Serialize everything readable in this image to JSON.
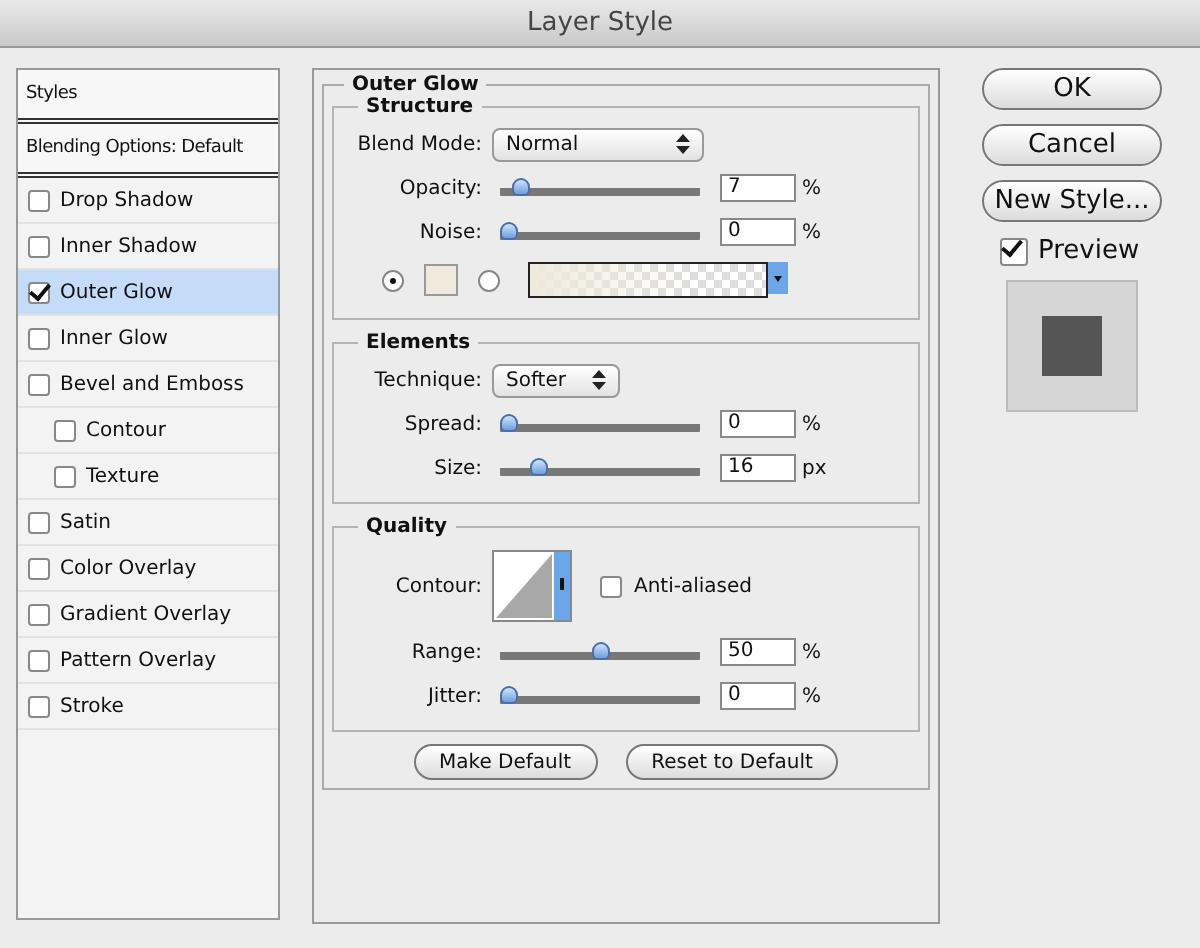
{
  "window": {
    "title": "Layer Style"
  },
  "styles_panel": {
    "header": "Styles",
    "blending": "Blending Options: Default",
    "items": [
      {
        "label": "Drop Shadow",
        "checked": false,
        "selected": false
      },
      {
        "label": "Inner Shadow",
        "checked": false,
        "selected": false
      },
      {
        "label": "Outer Glow",
        "checked": true,
        "selected": true
      },
      {
        "label": "Inner Glow",
        "checked": false,
        "selected": false
      },
      {
        "label": "Bevel and Emboss",
        "checked": false,
        "selected": false,
        "children": [
          {
            "label": "Contour",
            "checked": false,
            "selected": false
          },
          {
            "label": "Texture",
            "checked": false,
            "selected": false
          }
        ]
      },
      {
        "label": "Satin",
        "checked": false,
        "selected": false
      },
      {
        "label": "Color Overlay",
        "checked": false,
        "selected": false
      },
      {
        "label": "Gradient Overlay",
        "checked": false,
        "selected": false
      },
      {
        "label": "Pattern Overlay",
        "checked": false,
        "selected": false
      },
      {
        "label": "Stroke",
        "checked": false,
        "selected": false
      }
    ]
  },
  "outer_glow": {
    "title": "Outer Glow",
    "structure": {
      "title": "Structure",
      "blend_mode": {
        "label": "Blend Mode:",
        "value": "Normal"
      },
      "sliders": [
        {
          "label": "Opacity:",
          "level": 0.07,
          "value": "7",
          "unit": "%"
        },
        {
          "label": "Noise:",
          "level": 0,
          "value": "0",
          "unit": "%"
        }
      ],
      "fill": [
        {
          "kind": "color",
          "selected": true,
          "color": "#efeadb"
        },
        {
          "kind": "gradient",
          "selected": false,
          "color": "#efeadb"
        }
      ]
    },
    "elements": {
      "title": "Elements",
      "technique": {
        "label": "Technique:",
        "value": "Softer"
      },
      "sliders": [
        {
          "label": "Spread:",
          "level": 0,
          "value": "0",
          "unit": "%"
        },
        {
          "label": "Size:",
          "level": 0.16,
          "value": "16",
          "unit": "px"
        }
      ]
    },
    "quality": {
      "title": "Quality",
      "contour_label": "Contour:",
      "anti_aliased": {
        "label": "Anti-aliased",
        "checked": false
      },
      "sliders": [
        {
          "label": "Range:",
          "level": 0.5,
          "value": "50",
          "unit": "%"
        },
        {
          "label": "Jitter:",
          "level": 0,
          "value": "0",
          "unit": "%"
        }
      ]
    },
    "buttons": [
      "Make Default",
      "Reset to Default"
    ]
  },
  "actions": [
    "OK",
    "Cancel",
    "New Style..."
  ],
  "preview": {
    "label": "Preview",
    "checked": true
  }
}
